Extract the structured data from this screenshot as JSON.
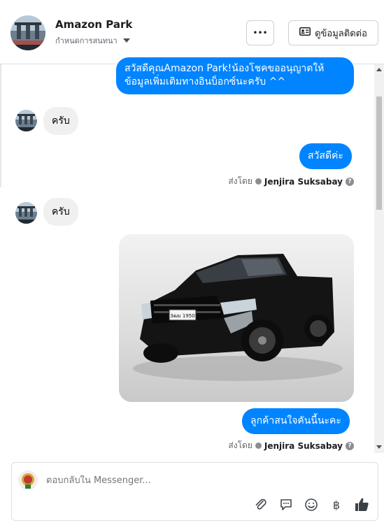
{
  "header": {
    "page_name": "Amazon Park",
    "assign_label": "กำหนดการสนทนา",
    "more_label": "•••",
    "contact_label": "ดูข้อมูลติดต่อ"
  },
  "messages": {
    "m1_line1": "สวัสดีคุณAmazon Park!น้องโชคขออนุญาตให้",
    "m1_line2": "ข้อมูลเพิ่มเติมทางอินบ็อกซ์นะครับ ^^",
    "m2": "ครับ",
    "m3": "สวัสดีค่ะ",
    "m4": "ครับ",
    "m5": "ลูกค้าสนใจคันนี้นะคะ",
    "sent_by_label": "ส่งโดย",
    "agent_name": "Jenjira Suksabay"
  },
  "photo": {
    "plate_text": "3ฒม 1950"
  },
  "composer": {
    "placeholder": "ตอบกลับใน Messenger..."
  },
  "icons": {
    "attach": "paperclip-icon",
    "template": "chat-bubble-icon",
    "emoji": "smiley-icon",
    "payment": "baht-icon",
    "like": "thumbs-up-icon"
  },
  "colors": {
    "bubble_out": "#0084ff",
    "bubble_in": "#f0f0f0",
    "like_icon": "#3b4045"
  }
}
